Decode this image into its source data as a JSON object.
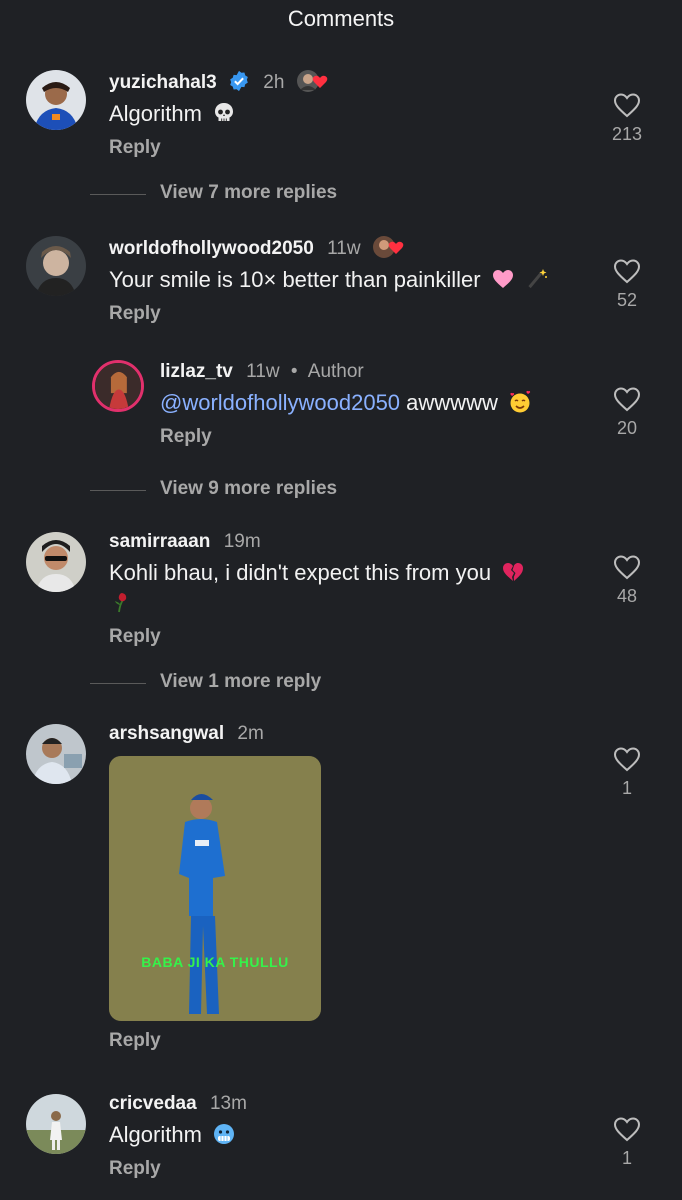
{
  "header": {
    "title": "Comments"
  },
  "comments": [
    {
      "username": "yuzichahal3",
      "time": "2h",
      "text": "Algorithm",
      "emoji": "skull-icon",
      "reply": "Reply",
      "likes": "213",
      "verified": true
    },
    {
      "username": "worldofhollywood2050",
      "time": "11w",
      "text": "Your smile is 10× better than painkiller",
      "emoji": "pink-heart-and-wand-icon",
      "reply": "Reply",
      "likes": "52"
    },
    {
      "username": "lizlaz_tv",
      "time": "11w",
      "author_label": "Author",
      "mention": "@worldofhollywood2050",
      "text": "awwwww",
      "emoji": "smiling-face-with-hearts-icon",
      "reply": "Reply",
      "likes": "20"
    },
    {
      "username": "samirraaan",
      "time": "19m",
      "text": "Kohli bhau, i didn't expect this from you",
      "emoji": "broken-heart-and-wilted-flower-icon",
      "reply": "Reply",
      "likes": "48"
    },
    {
      "username": "arshsangwal",
      "time": "2m",
      "gif_caption": "BABA JI KA THULLU",
      "reply": "Reply",
      "likes": "1"
    },
    {
      "username": "cricvedaa",
      "time": "13m",
      "text": "Algorithm",
      "emoji": "freezing-face-icon",
      "reply": "Reply",
      "likes": "1"
    }
  ],
  "view_more": [
    "View 7 more replies",
    "View 9 more replies",
    "View 1 more reply"
  ],
  "colors": {
    "background": "#1f2125",
    "mention": "#8ab1ff",
    "verified": "#3897f0",
    "gif_caption": "#35f24a"
  }
}
